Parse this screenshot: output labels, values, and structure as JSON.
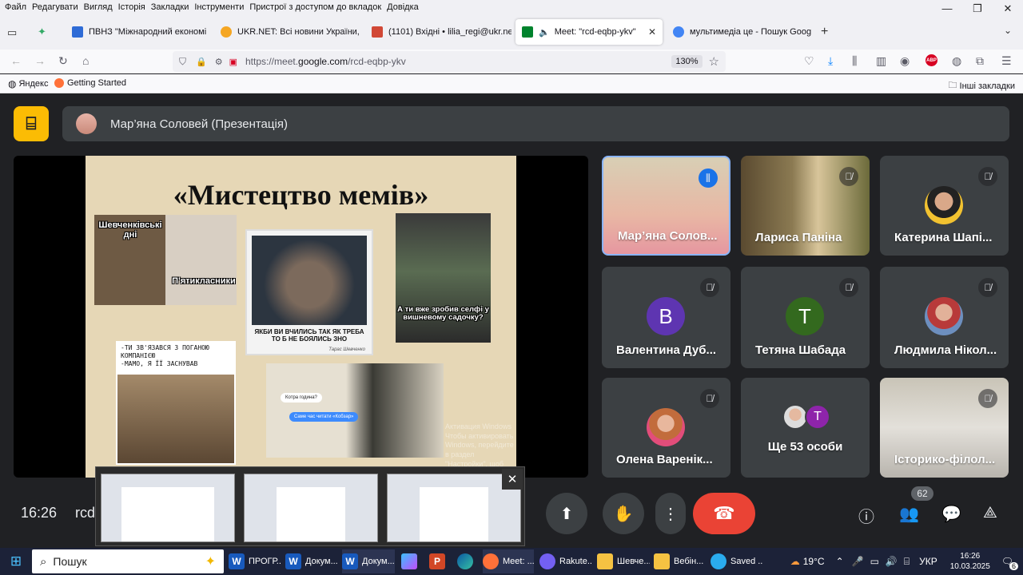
{
  "menubar": {
    "items": [
      "Файл",
      "Редагувати",
      "Вигляд",
      "Історія",
      "Закладки",
      "Інструменти",
      "Пристрої з доступом до вкладок",
      "Довідка"
    ]
  },
  "tabs": [
    {
      "title": "ПВНЗ \"Міжнародний економі",
      "color": "#2e6bd6"
    },
    {
      "title": "UKR.NET: Всі новини України, ос",
      "color": "#f5a623"
    },
    {
      "title": "(1101) Вхідні • lilia_regi@ukr.ne",
      "color": "#d14836"
    },
    {
      "title": "Meet: \"rcd-eqbp-ykv\"",
      "color": "#00832d"
    },
    {
      "title": "мультимедіа це - Пошук Goog",
      "color": "#4285f4"
    }
  ],
  "url": {
    "prefix": "https://meet.",
    "domain": "google.com",
    "path": "/rcd-eqbp-ykv",
    "zoom": "130%"
  },
  "bookmarks": {
    "yandex": "Яндекс",
    "getting_started": "Getting Started",
    "other": "Інші закладки"
  },
  "presenter": {
    "label": "Мар’яна Соловей (Презентація)"
  },
  "slide": {
    "title": "«Мистецтво мемів»",
    "meme1_top": "Шевченківські дні",
    "meme1_bottom": "П'ятикласники",
    "meme2_caption": "ЯКБИ ВИ ВЧИЛИСЬ ТАК ЯК ТРЕБА ТО Б НЕ БОЯЛИСЬ ЗНО",
    "meme2_sign": "Тарас Шевченко",
    "meme3_caption": "А ти вже зробив селфі у вишневому садочку?",
    "meme4_caption": "-ТИ ЗВ'ЯЗАВСЯ З ПОГАНОЮ КОМПАНІЄЮ\n-МАМО, Я ЇЇ ЗАСНУВАВ",
    "bubble1": "Котра година?",
    "bubble2": "Саме час читати «Кобзар»",
    "watermark": "Активация Windows\nЧтобы активировать Windows, перейдите в раздел \"Настройки\", щоб"
  },
  "participants": [
    {
      "name": "Мар’яна Солов...",
      "speaking": true
    },
    {
      "name": "Лариса Паніна",
      "muted": true
    },
    {
      "name": "Катерина Шапі...",
      "muted": true
    },
    {
      "name": "Валентина Дуб...",
      "initial": "B",
      "color": "#5e35b1",
      "muted": true
    },
    {
      "name": "Тетяна Шабада",
      "initial": "T",
      "color": "#33691e",
      "muted": true
    },
    {
      "name": "Людмила Нікол...",
      "muted": true
    },
    {
      "name": "Олена Варенік...",
      "muted": true
    },
    {
      "name": "Ще 53 особи",
      "initial": "T",
      "color": "#8e24aa"
    },
    {
      "name": "Історико-філол...",
      "muted": true
    }
  ],
  "controls": {
    "time": "16:26",
    "code": "rcd",
    "participant_count": "62"
  },
  "taskbar": {
    "search_placeholder": "Пошук",
    "apps": [
      "ПРОГР...",
      "Докум...",
      "Докум...",
      "",
      "",
      "",
      "Meet: ...",
      "Rakute...",
      "Шевче...",
      "Вебін...",
      "Saved ..."
    ],
    "weather": "19°C",
    "lang": "УКР",
    "time": "16:26",
    "date": "10.03.2025",
    "notifications": "6"
  },
  "colors": {
    "accent": "#8ab4f8",
    "endcall": "#ea4335",
    "meet_bg": "#202124",
    "tile_bg": "#3c4043"
  }
}
